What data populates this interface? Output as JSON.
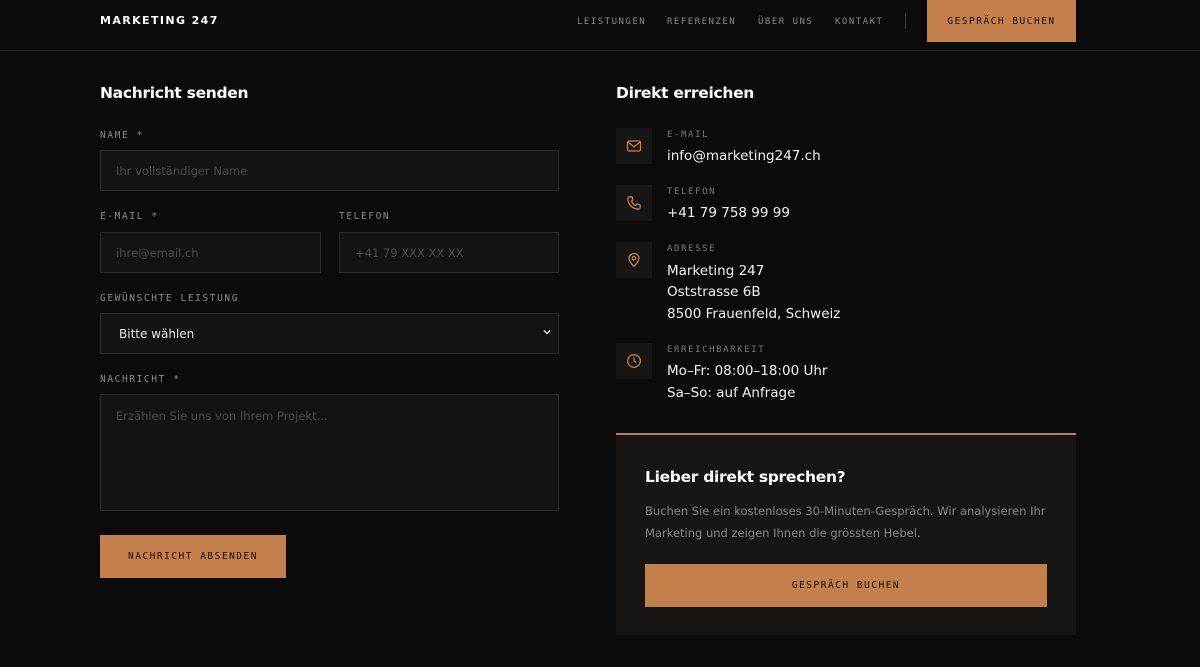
{
  "header": {
    "logo": "MARKETING 247",
    "nav": [
      "LEISTUNGEN",
      "REFERENZEN",
      "ÜBER UNS",
      "KONTAKT"
    ],
    "cta": "GESPRÄCH BUCHEN"
  },
  "form": {
    "title": "Nachricht senden",
    "name_label": "NAME *",
    "name_placeholder": "Ihr vollständiger Name",
    "email_label": "E-MAIL *",
    "email_placeholder": "ihre@email.ch",
    "phone_label": "TELEFON",
    "phone_placeholder": "+41 79 XXX XX XX",
    "service_label": "GEWÜNSCHTE LEISTUNG",
    "service_value": "Bitte wählen",
    "message_label": "NACHRICHT *",
    "message_placeholder": "Erzählen Sie uns von Ihrem Projekt...",
    "submit": "NACHRICHT ABSENDEN"
  },
  "contact": {
    "title": "Direkt erreichen",
    "email": {
      "icon": "mail-icon",
      "label": "E-MAIL",
      "value": "info@marketing247.ch"
    },
    "phone": {
      "icon": "phone-icon",
      "label": "TELEFON",
      "value": "+41 79 758 99 99"
    },
    "address": {
      "icon": "map-pin-icon",
      "label": "ADRESSE",
      "lines": [
        "Marketing 247",
        "Oststrasse 6B",
        "8500 Frauenfeld, Schweiz"
      ]
    },
    "hours": {
      "icon": "clock-icon",
      "label": "ERREICHBARKEIT",
      "lines": [
        "Mo–Fr: 08:00–18:00 Uhr",
        "Sa–So: auf Anfrage"
      ]
    }
  },
  "cta_card": {
    "title": "Lieber direkt sprechen?",
    "text": "Buchen Sie ein kostenloses 30-Minuten-Gespräch. Wir analysieren Ihr Marketing und zeigen Ihnen die grössten Hebel.",
    "button": "GESPRÄCH BUCHEN"
  },
  "colors": {
    "background": "#0b0b0b",
    "accent": "#c4804b",
    "field_bg": "#141312",
    "card_bg": "#171615"
  }
}
